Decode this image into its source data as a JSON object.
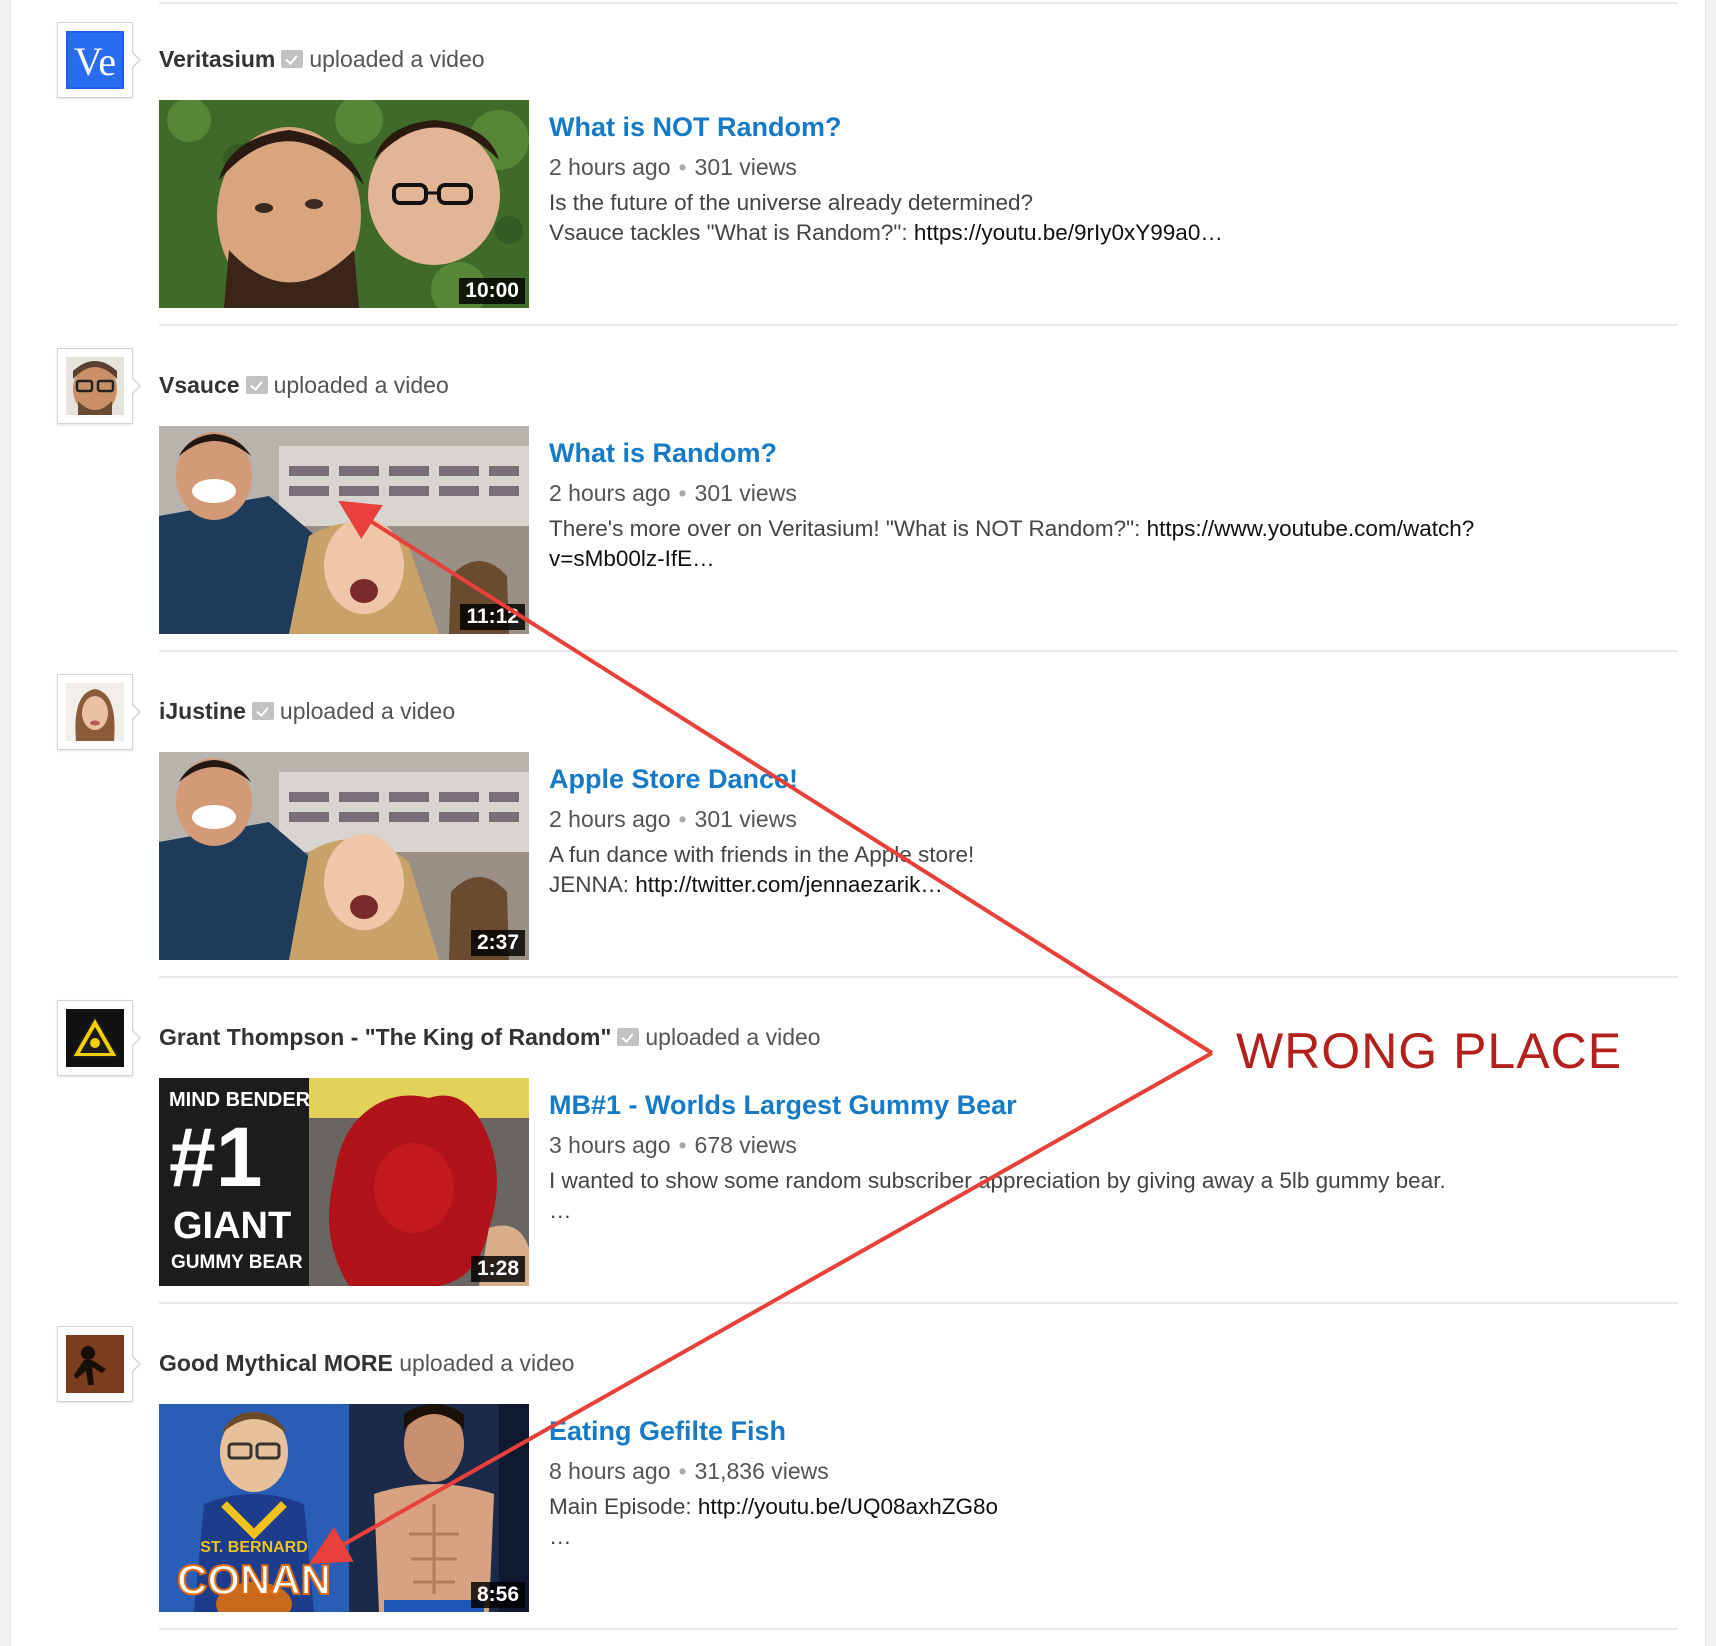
{
  "feed": {
    "action_text": "uploaded a video",
    "items": [
      {
        "channel": "Veritasium",
        "verified": true,
        "avatar": "veritasium-logo",
        "title": "What is NOT Random?",
        "time": "2 hours ago",
        "views": "301 views",
        "desc1": "Is the future of the universe already determined?",
        "desc2_text": "Vsauce tackles \"What is Random?\": ",
        "desc2_link": "https://youtu.be/9rIy0xY99a0…",
        "duration": "10:00"
      },
      {
        "channel": "Vsauce",
        "verified": true,
        "avatar": "vsauce-face",
        "title": "What is Random?",
        "time": "2 hours ago",
        "views": "301 views",
        "desc1_text": "There's more over on Veritasium! \"What is NOT Random?\": ",
        "desc1_link": "https://www.youtube.com/watch?",
        "desc2": "v=sMb00lz-IfE…",
        "duration": "11:12"
      },
      {
        "channel": "iJustine",
        "verified": true,
        "avatar": "ijustine-face",
        "title": "Apple Store Dance!",
        "time": "2 hours ago",
        "views": "301 views",
        "desc1": "A fun dance with friends in the Apple store!",
        "desc2_text": "JENNA: ",
        "desc2_link": "http://twitter.com/jennaezarik…",
        "duration": "2:37"
      },
      {
        "channel": "Grant Thompson - \"The King of Random\"",
        "verified": true,
        "avatar": "king-of-random-logo",
        "title": "MB#1 - Worlds Largest Gummy Bear",
        "time": "3 hours ago",
        "views": "678 views",
        "desc1": "I wanted to show some random subscriber appreciation by giving away a 5lb gummy bear.",
        "desc2": "…",
        "duration": "1:28",
        "thumb_text": {
          "line1": "MIND BENDER",
          "line2": "#1",
          "line3": "GIANT",
          "line4": "GUMMY BEAR"
        }
      },
      {
        "channel": "Good Mythical MORE",
        "verified": false,
        "avatar": "good-mythical-logo",
        "title": "Eating Gefilte Fish",
        "time": "8 hours ago",
        "views": "31,836 views",
        "desc1_text": "Main Episode: ",
        "desc1_link": "http://youtu.be/UQ08axhZG8o",
        "desc2": "…",
        "duration": "8:56",
        "thumb_text": {
          "jersey": "ST. BERNARD",
          "logo": "CONAN"
        }
      }
    ]
  },
  "annotation": {
    "label": "WRONG PLACE",
    "color": "#e8403a",
    "label_color": "#b3201e"
  },
  "colors": {
    "title_link": "#167ac6",
    "separator": "#e8e8e8"
  }
}
